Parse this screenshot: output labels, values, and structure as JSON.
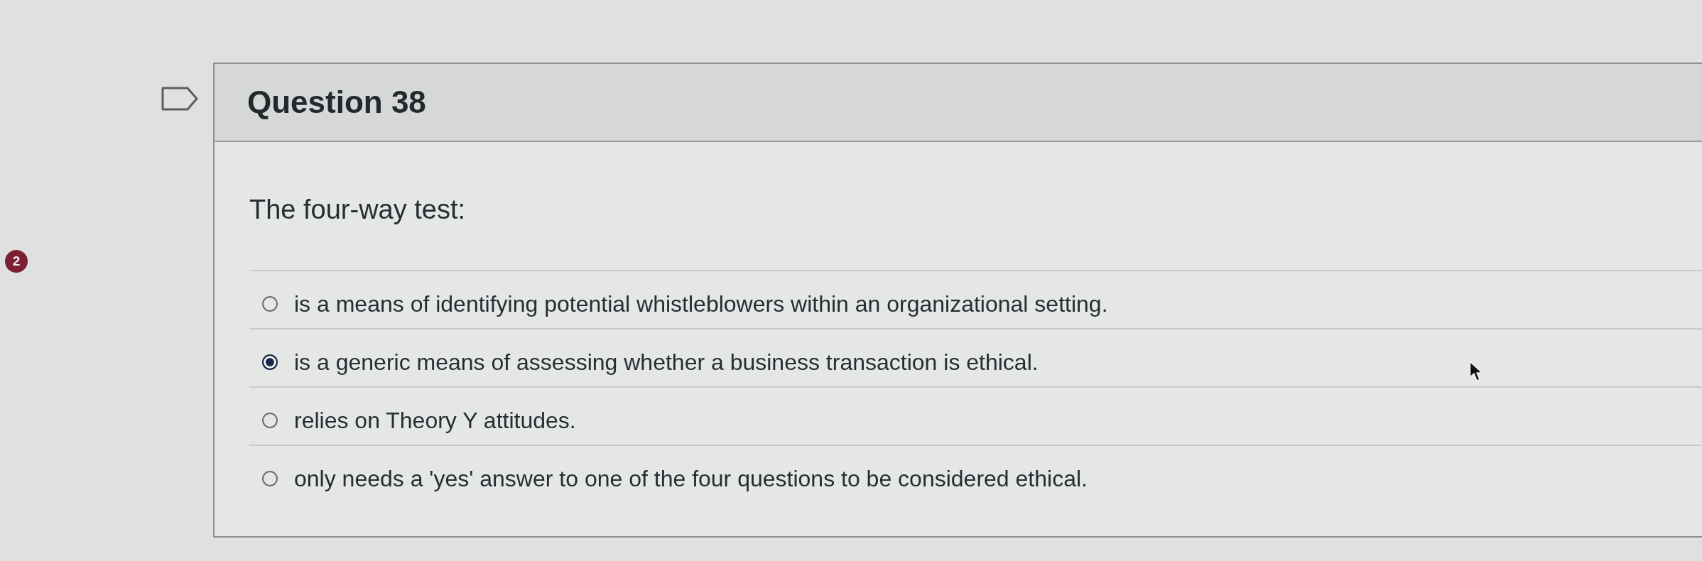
{
  "side_badge": {
    "count": "2"
  },
  "question": {
    "flagged": false,
    "title": "Question 38",
    "prompt": "The four-way test:",
    "options": [
      {
        "label": "is a means of identifying potential whistleblowers within an organizational setting.",
        "selected": false
      },
      {
        "label": "is a generic means of assessing whether a business transaction is ethical.",
        "selected": true
      },
      {
        "label": "relies on Theory Y attitudes.",
        "selected": false
      },
      {
        "label": "only needs a 'yes' answer to one of the four questions to be considered ethical.",
        "selected": false
      }
    ]
  }
}
